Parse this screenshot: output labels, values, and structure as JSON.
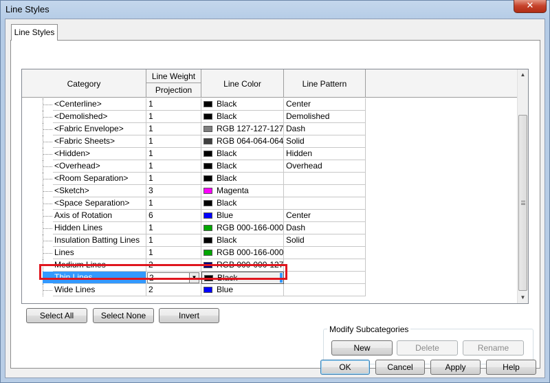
{
  "window": {
    "title": "Line Styles",
    "close_glyph": "✕"
  },
  "tab": {
    "label": "Line Styles"
  },
  "table": {
    "headers": {
      "category": "Category",
      "line_weight": "Line Weight",
      "projection": "Projection",
      "line_color": "Line Color",
      "line_pattern": "Line Pattern"
    },
    "rows": [
      {
        "category": "<Centerline>",
        "weight": "1",
        "color": "Black",
        "swatch": "#000000",
        "pattern": "Center"
      },
      {
        "category": "<Demolished>",
        "weight": "1",
        "color": "Black",
        "swatch": "#000000",
        "pattern": "Demolished"
      },
      {
        "category": "<Fabric Envelope>",
        "weight": "1",
        "color": "RGB 127-127-127",
        "swatch": "#7f7f7f",
        "pattern": "Dash"
      },
      {
        "category": "<Fabric Sheets>",
        "weight": "1",
        "color": "RGB 064-064-064",
        "swatch": "#404040",
        "pattern": "Solid"
      },
      {
        "category": "<Hidden>",
        "weight": "1",
        "color": "Black",
        "swatch": "#000000",
        "pattern": "Hidden"
      },
      {
        "category": "<Overhead>",
        "weight": "1",
        "color": "Black",
        "swatch": "#000000",
        "pattern": "Overhead"
      },
      {
        "category": "<Room Separation>",
        "weight": "1",
        "color": "Black",
        "swatch": "#000000",
        "pattern": ""
      },
      {
        "category": "<Sketch>",
        "weight": "3",
        "color": "Magenta",
        "swatch": "#ff00ff",
        "pattern": ""
      },
      {
        "category": "<Space Separation>",
        "weight": "1",
        "color": "Black",
        "swatch": "#000000",
        "pattern": ""
      },
      {
        "category": "Axis of Rotation",
        "weight": "6",
        "color": "Blue",
        "swatch": "#0000ff",
        "pattern": "Center"
      },
      {
        "category": "Hidden Lines",
        "weight": "1",
        "color": "RGB 000-166-000",
        "swatch": "#00a600",
        "pattern": "Dash"
      },
      {
        "category": "Insulation Batting Lines",
        "weight": "1",
        "color": "Black",
        "swatch": "#000000",
        "pattern": "Solid"
      },
      {
        "category": "Lines",
        "weight": "1",
        "color": "RGB 000-166-000",
        "swatch": "#00a600",
        "pattern": ""
      },
      {
        "category": "Medium Lines",
        "weight": "2",
        "color": "RGB 000-000-127",
        "swatch": "#00007f",
        "pattern": ""
      },
      {
        "category": "Thin Lines",
        "weight": "2",
        "color": "Black",
        "swatch": "#000000",
        "pattern": "",
        "selected": true
      },
      {
        "category": "Wide Lines",
        "weight": "2",
        "color": "Blue",
        "swatch": "#0000ff",
        "pattern": ""
      }
    ]
  },
  "selection_buttons": {
    "select_all": "Select All",
    "select_none": "Select None",
    "invert": "Invert"
  },
  "modify_subcategories": {
    "label": "Modify Subcategories",
    "new": "New",
    "delete": "Delete",
    "rename": "Rename"
  },
  "dialog_buttons": {
    "ok": "OK",
    "cancel": "Cancel",
    "apply": "Apply",
    "help": "Help"
  },
  "colors": {
    "selection": "#3399ff",
    "highlight_box": "#e0161e"
  }
}
